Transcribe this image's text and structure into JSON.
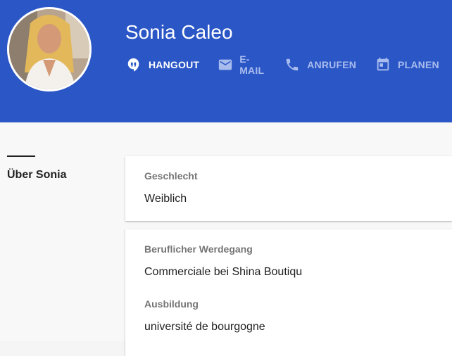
{
  "profile": {
    "name": "Sonia Caleo"
  },
  "actions": [
    {
      "label": "HANGOUT",
      "icon": "hangout-quote-icon",
      "active": true
    },
    {
      "label": "E-MAIL",
      "icon": "email-icon",
      "active": false
    },
    {
      "label": "ANRUFEN",
      "icon": "phone-icon",
      "active": false
    },
    {
      "label": "PLANEN",
      "icon": "calendar-icon",
      "active": false
    }
  ],
  "about": {
    "section_title": "Über Sonia",
    "cards": [
      {
        "fields": [
          {
            "label": "Geschlecht",
            "value": "Weiblich"
          }
        ]
      },
      {
        "fields": [
          {
            "label": "Beruflicher Werdegang",
            "value": "Commerciale bei Shina Boutiqu"
          },
          {
            "label": "Ausbildung",
            "value": "université de bourgogne"
          }
        ]
      }
    ]
  },
  "colors": {
    "header_bg": "#2a56c6",
    "active_action": "#ffffff",
    "inactive_action": "#a9bcee"
  }
}
